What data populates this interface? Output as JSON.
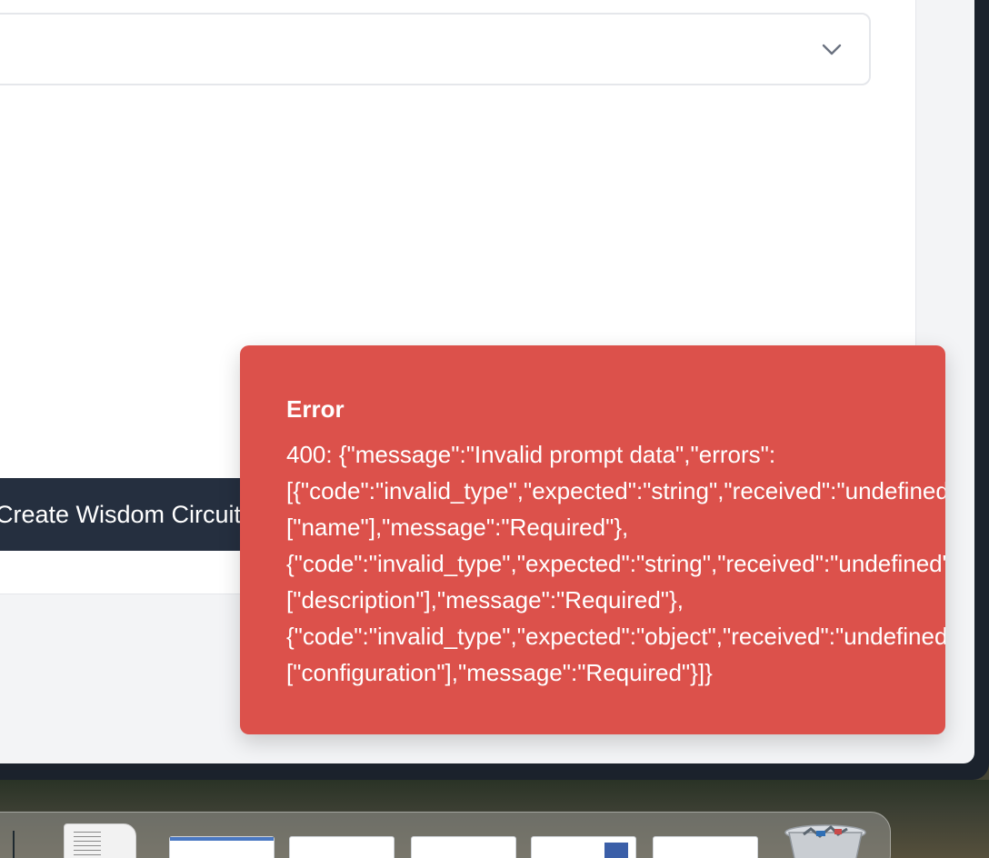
{
  "form": {
    "select": {
      "value": "",
      "chevron_icon": "chevron-down-icon"
    },
    "submit_label": "Create Wisdom Circuit"
  },
  "toast": {
    "title": "Error",
    "lines": [
      "400: {\"message\":\"Invalid prompt data\",\"errors\":",
      "[{\"code\":\"invalid_type\",\"expected\":\"string\",\"received\":\"undefined\",\"path\":",
      "[\"name\"],\"message\":\"Required\"},",
      "{\"code\":\"invalid_type\",\"expected\":\"string\",\"received\":\"undefined\",\"path\":",
      "[\"description\"],\"message\":\"Required\"},",
      "{\"code\":\"invalid_type\",\"expected\":\"object\",\"received\":\"undefined\",\"path\":",
      "[\"configuration\"],\"message\":\"Required\"}]}"
    ],
    "background_color": "#dc514b"
  },
  "dock": {
    "items": [
      {
        "name": "document-icon"
      },
      {
        "name": "window-thumbnail-1"
      },
      {
        "name": "window-thumbnail-2"
      },
      {
        "name": "window-thumbnail-3"
      },
      {
        "name": "window-thumbnail-4"
      },
      {
        "name": "window-thumbnail-5"
      },
      {
        "name": "trash-icon"
      }
    ]
  }
}
